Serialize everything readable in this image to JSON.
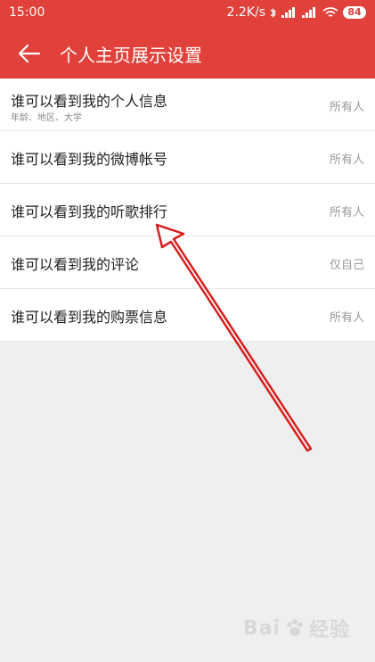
{
  "status_bar": {
    "time": "15:00",
    "network_speed": "2.2K/s",
    "battery": "84"
  },
  "header": {
    "title": "个人主页展示设置"
  },
  "settings": [
    {
      "label": "谁可以看到我的个人信息",
      "sub": "年龄、地区、大学",
      "value": "所有人"
    },
    {
      "label": "谁可以看到我的微博帐号",
      "value": "所有人"
    },
    {
      "label": "谁可以看到我的听歌排行",
      "value": "所有人"
    },
    {
      "label": "谁可以看到我的评论",
      "value": "仅自己"
    },
    {
      "label": "谁可以看到我的购票信息",
      "value": "所有人"
    }
  ],
  "watermark": {
    "brand": "Bai",
    "suffix": "经验"
  },
  "colors": {
    "accent": "#e0413a",
    "annotation": "#d81e1e"
  }
}
